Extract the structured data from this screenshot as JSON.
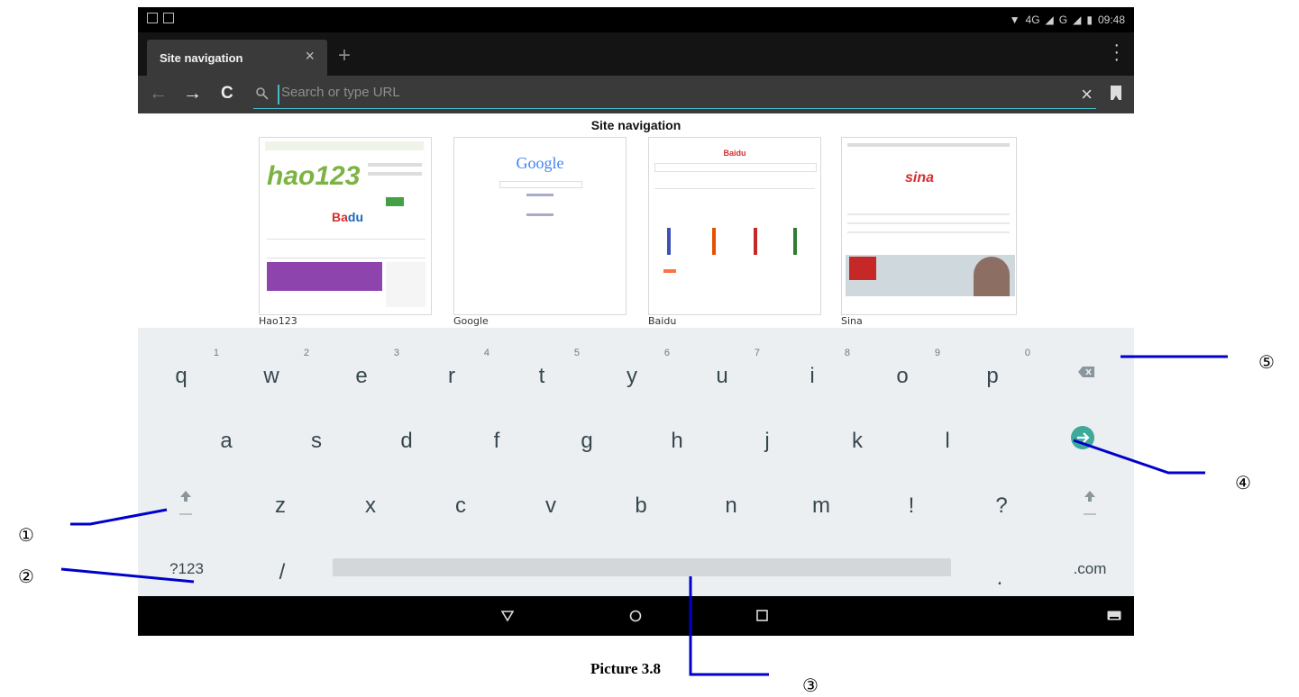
{
  "status_bar": {
    "network": "4G",
    "network2": "G",
    "time": "09:48"
  },
  "tab": {
    "title": "Site navigation",
    "close_glyph": "×",
    "new_tab_glyph": "+"
  },
  "url_bar": {
    "placeholder": "Search or type URL",
    "back_glyph": "←",
    "forward_glyph": "→",
    "reload_glyph": "C",
    "clear_glyph": "×"
  },
  "site_navigation": {
    "title": "Site navigation",
    "sites": [
      {
        "label": "Hao123",
        "logo": "hao123"
      },
      {
        "label": "Google",
        "logo": "Google"
      },
      {
        "label": "Baidu",
        "logo": "Baidu"
      },
      {
        "label": "Sina",
        "logo": "sina"
      }
    ]
  },
  "keyboard": {
    "row1": [
      {
        "key": "q",
        "hint": "1"
      },
      {
        "key": "w",
        "hint": "2"
      },
      {
        "key": "e",
        "hint": "3"
      },
      {
        "key": "r",
        "hint": "4"
      },
      {
        "key": "t",
        "hint": "5"
      },
      {
        "key": "y",
        "hint": "6"
      },
      {
        "key": "u",
        "hint": "7"
      },
      {
        "key": "i",
        "hint": "8"
      },
      {
        "key": "o",
        "hint": "9"
      },
      {
        "key": "p",
        "hint": "0"
      }
    ],
    "row2": [
      "a",
      "s",
      "d",
      "f",
      "g",
      "h",
      "j",
      "k",
      "l"
    ],
    "row3": [
      "z",
      "x",
      "c",
      "v",
      "b",
      "n",
      "m",
      "!",
      "?"
    ],
    "row4": {
      "symbols": "?123",
      "slash": "/",
      "period": ".",
      "com": ".com"
    }
  },
  "callouts": {
    "c1": "①",
    "c2": "②",
    "c3": "③",
    "c4": "④",
    "c5": "⑤"
  },
  "caption": "Picture 3.8",
  "colors": {
    "accent": "#49b7c4",
    "go_button": "#3fa99a",
    "keyboard_bg": "#eceff1",
    "key_text": "#37474f"
  }
}
